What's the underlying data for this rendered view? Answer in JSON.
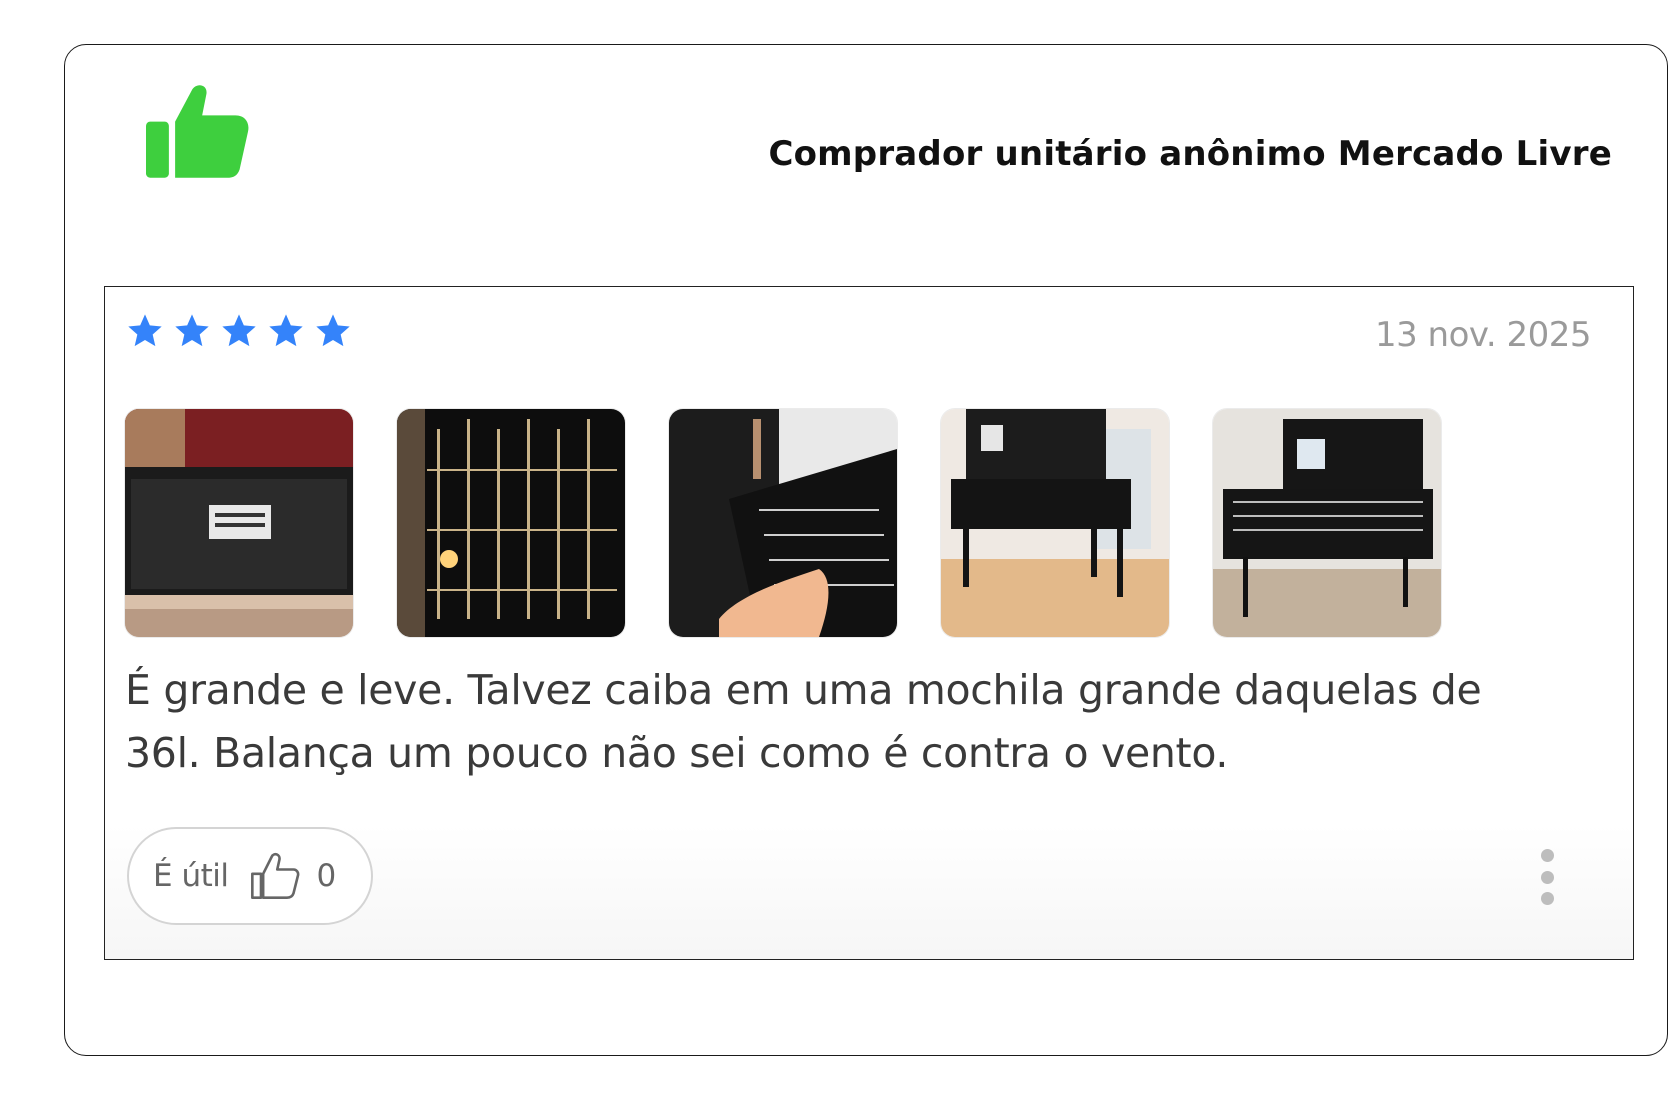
{
  "header": {
    "buyer_label": "Comprador unitário anônimo Mercado Livre",
    "logo_icon": "thumbs-up-icon",
    "logo_color": "#3ecf3e"
  },
  "review": {
    "rating": 5,
    "rating_max": 5,
    "star_color": "#3483fa",
    "star_icon": "star-icon",
    "date": "13 nov. 2025",
    "photos": [
      {
        "icon": "photo-grill-box"
      },
      {
        "icon": "photo-grill-grate-closeup"
      },
      {
        "icon": "photo-grill-hand"
      },
      {
        "icon": "photo-grill-assembled"
      },
      {
        "icon": "photo-grill-side"
      }
    ],
    "text": "É grande e leve. Talvez caiba em uma mochila grande daquelas de 36l. Balança um pouco não sei como é contra o vento.",
    "useful_button": {
      "label": "É útil",
      "icon": "thumbs-up-outline-icon",
      "count": "0"
    },
    "more_icon": "more-vertical-icon"
  }
}
